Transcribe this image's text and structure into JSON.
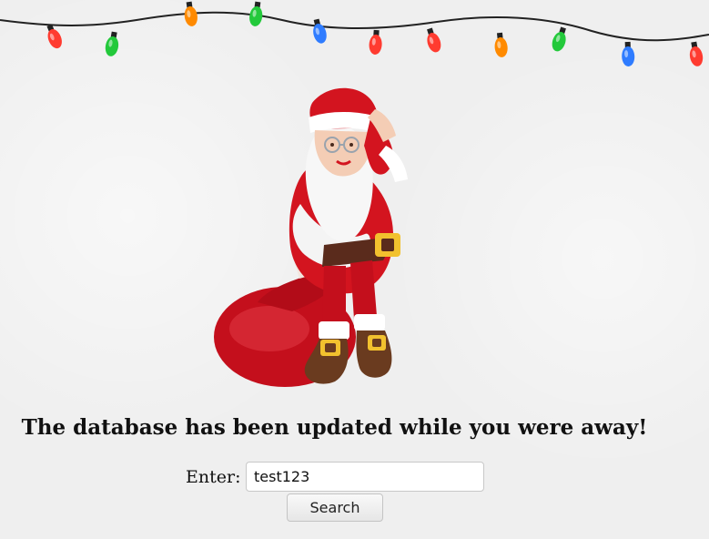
{
  "headline": "The database has been updated while you were away!",
  "form": {
    "label": "Enter:",
    "input_value": "test123",
    "button_label": "Search"
  },
  "decor": {
    "lights_colors": [
      "#ff3b30",
      "#23c93b",
      "#ff8a00",
      "#23c93b",
      "#2f7cff",
      "#ff3b30",
      "#ff3b30",
      "#ff8a00",
      "#23c93b",
      "#2f7cff",
      "#ff3b30"
    ],
    "santa_primary": "#d3141f",
    "santa_trim": "#ffffff",
    "belt": "#5a2b1c",
    "buckle": "#f2c12e"
  }
}
